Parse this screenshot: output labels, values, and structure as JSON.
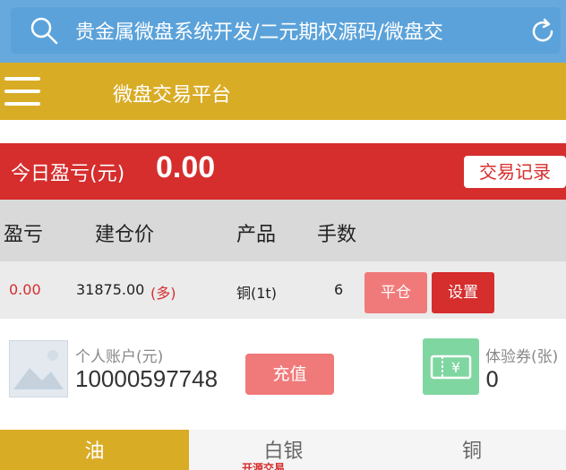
{
  "search": {
    "text": "贵金属微盘系统开发/二元期权源码/微盘交"
  },
  "header": {
    "title": "微盘交易平台"
  },
  "pnl": {
    "label": "今日盈亏(元)",
    "value": "0.00",
    "trade_record_label": "交易记录"
  },
  "table": {
    "headers": [
      "盈亏",
      "建仓价",
      "产品",
      "手数"
    ],
    "rows": [
      {
        "pnl": "0.00",
        "open_price": "31875.00",
        "direction": "(多)",
        "product": "铜(1t)",
        "lots": "6",
        "close_label": "平仓",
        "settings_label": "设置"
      }
    ]
  },
  "account": {
    "label": "个人账户(元)",
    "value": "10000597748",
    "recharge_label": "充值"
  },
  "coupon": {
    "label": "体验券(张)",
    "value": "0"
  },
  "tabs": [
    {
      "label": "油",
      "active": true
    },
    {
      "label": "白银",
      "active": false
    },
    {
      "label": "铜",
      "active": false
    }
  ],
  "tab_sub": {
    "text": "开源交易"
  },
  "colors": {
    "search_bg": "#68a9dd",
    "header_bg": "#d9ac26",
    "banner_red": "#d62d2d",
    "button_pink": "#f07a7a",
    "coupon_green": "#7fd6a1"
  }
}
